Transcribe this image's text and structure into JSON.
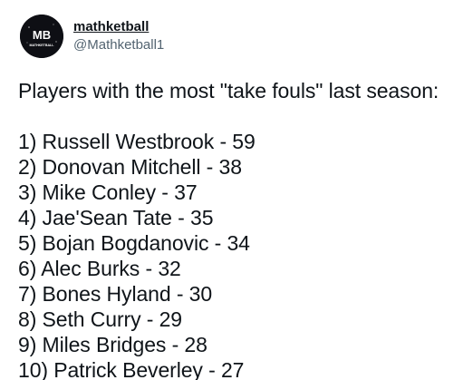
{
  "author": {
    "display_name": "mathketball",
    "handle": "@Mathketball1",
    "avatar": {
      "initials": "MB",
      "caption": "MATHKETBALL",
      "bg_color": "#0e0f14",
      "text_color": "#ffffff"
    }
  },
  "tweet": {
    "intro": "Players with the most \"take fouls\" last season:",
    "items": [
      "1) Russell Westbrook - 59",
      "2) Donovan Mitchell - 38",
      "3) Mike Conley - 37",
      "4) Jae'Sean Tate - 35",
      "5) Bojan Bogdanovic - 34",
      "6) Alec Burks - 32",
      "7) Bones Hyland - 30",
      "8) Seth Curry - 29",
      "9) Miles Bridges - 28",
      "10) Patrick Beverley - 27"
    ]
  }
}
